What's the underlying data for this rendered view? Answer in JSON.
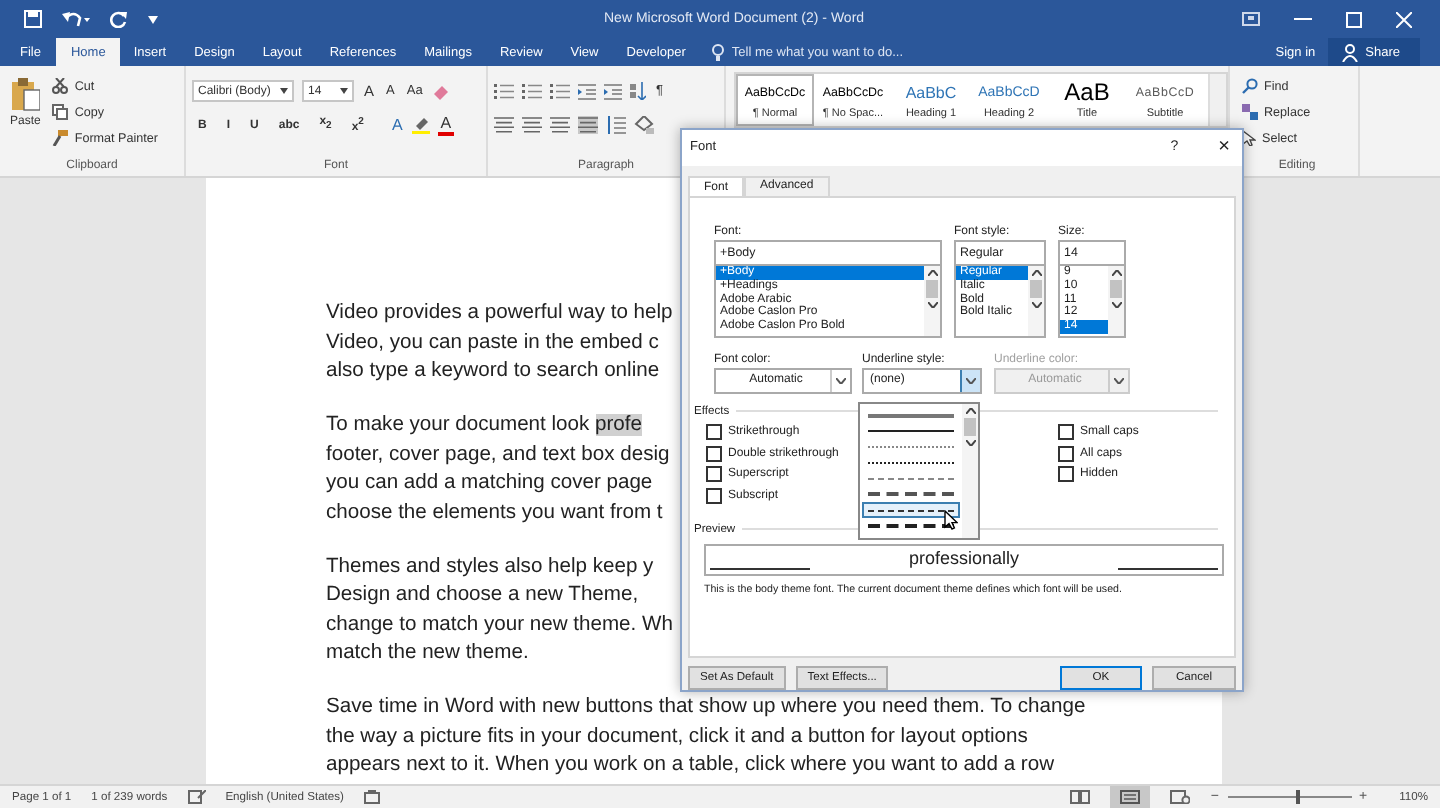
{
  "window": {
    "title": "New Microsoft Word Document (2) - Word"
  },
  "ribbon_tabs": [
    {
      "label": "File",
      "kind": "file",
      "selected": false
    },
    {
      "label": "Home",
      "kind": "tab",
      "selected": true
    },
    {
      "label": "Insert",
      "kind": "tab",
      "selected": false
    },
    {
      "label": "Design",
      "kind": "tab",
      "selected": false
    },
    {
      "label": "Layout",
      "kind": "tab",
      "selected": false
    },
    {
      "label": "References",
      "kind": "tab",
      "selected": false
    },
    {
      "label": "Mailings",
      "kind": "tab",
      "selected": false
    },
    {
      "label": "Review",
      "kind": "tab",
      "selected": false
    },
    {
      "label": "View",
      "kind": "tab",
      "selected": false
    },
    {
      "label": "Developer",
      "kind": "tab",
      "selected": false
    }
  ],
  "tell_me": {
    "placeholder": "Tell me what you want to do..."
  },
  "account": {
    "sign_in": "Sign in",
    "share": "Share"
  },
  "clipboard": {
    "paste": "Paste",
    "cut": "Cut",
    "copy": "Copy",
    "format_painter": "Format Painter",
    "label": "Clipboard"
  },
  "font_group": {
    "name": "Calibri (Body)",
    "size": "14",
    "grow": "A",
    "shrink": "A",
    "change_case": "Aa",
    "format_buttons": [
      "B",
      "I",
      "U",
      "abc",
      "x$_{2}$",
      "x$^{2}$"
    ],
    "text_effects": "A",
    "font_color": "A",
    "label": "Font"
  },
  "paragraph_group": {
    "pilcrow": "¶",
    "label": "Paragraph"
  },
  "styles": [
    {
      "preview": "AaBbCcDc",
      "name": "¶ Normal",
      "kind": "normal",
      "selected": true
    },
    {
      "preview": "AaBbCcDc",
      "name": "¶ No Spac...",
      "kind": "normal",
      "selected": false
    },
    {
      "preview": "AaBbC",
      "name": "Heading 1",
      "kind": "heading1",
      "selected": false
    },
    {
      "preview": "AaBbCcD",
      "name": "Heading 2",
      "kind": "heading2",
      "selected": false
    },
    {
      "preview": "AaB",
      "name": "Title",
      "kind": "title",
      "selected": false
    },
    {
      "preview": "AaBbCcD",
      "name": "Subtitle",
      "kind": "subtitle",
      "selected": false
    }
  ],
  "editing": {
    "find": "Find",
    "replace": "Replace",
    "select": "Select",
    "label": "Editing"
  },
  "document": {
    "paragraphs": [
      {
        "lines": [
          {
            "text": "Video provides a powerful way to help"
          },
          {
            "text": "Video, you can paste in the embed c"
          },
          {
            "text": "also type a keyword to search online"
          }
        ]
      },
      {
        "lines": [
          {
            "text": "To make your document look ",
            "selection": "profe"
          },
          {
            "text": "footer, cover page, and text box desig"
          },
          {
            "text": "you can add a matching cover page"
          },
          {
            "text": "choose the elements you want from t"
          }
        ]
      },
      {
        "lines": [
          {
            "text": "Themes and styles also help keep y"
          },
          {
            "text": "Design and choose a new Theme,"
          },
          {
            "text": "change to match your new theme. Wh"
          },
          {
            "text": "match the new theme."
          }
        ]
      },
      {
        "lines": [
          {
            "text": "Save time in Word with new buttons that show up where you need them. To change"
          },
          {
            "text": "the way a picture fits in your document, click it and a button for layout options"
          },
          {
            "text": "appears next to it. When you work on a table, click where you want to add a row"
          }
        ]
      }
    ]
  },
  "font_dialog": {
    "title": "Font",
    "help": "?",
    "close": "×",
    "tabs": [
      {
        "label": "Font",
        "selected": true
      },
      {
        "label": "Advanced",
        "selected": false
      }
    ],
    "font": {
      "label": "Font:",
      "value": "+Body",
      "items": [
        {
          "label": "+Body",
          "selected": true
        },
        {
          "label": "+Headings",
          "selected": false
        },
        {
          "label": "Adobe Arabic",
          "selected": false
        },
        {
          "label": "Adobe Caslon Pro",
          "selected": false
        },
        {
          "label": "Adobe Caslon Pro Bold",
          "selected": false
        }
      ]
    },
    "font_style": {
      "label": "Font style:",
      "value": "Regular",
      "items": [
        {
          "label": "Regular",
          "selected": true
        },
        {
          "label": "Italic",
          "selected": false
        },
        {
          "label": "Bold",
          "selected": false
        },
        {
          "label": "Bold Italic",
          "selected": false
        }
      ]
    },
    "size": {
      "label": "Size:",
      "value": "14",
      "items": [
        {
          "label": "9",
          "selected": false
        },
        {
          "label": "10",
          "selected": false
        },
        {
          "label": "11",
          "selected": false
        },
        {
          "label": "12",
          "selected": false
        },
        {
          "label": "14",
          "selected": true
        }
      ]
    },
    "font_color": {
      "label": "Font color:",
      "value": "Automatic",
      "disabled": false
    },
    "underline_style": {
      "label": "Underline style:",
      "value": "(none)",
      "expanded": true,
      "disabled": false,
      "options": [
        {
          "kind": "words",
          "selected": false
        },
        {
          "kind": "solid",
          "selected": false
        },
        {
          "kind": "dotted",
          "selected": false
        },
        {
          "kind": "dense",
          "selected": false
        },
        {
          "kind": "dashed",
          "selected": false
        },
        {
          "kind": "heavy",
          "selected": false
        },
        {
          "kind": "long",
          "selected": true
        },
        {
          "kind": "longheavy",
          "selected": false
        }
      ]
    },
    "underline_color": {
      "label": "Underline color:",
      "value": "Automatic",
      "disabled": true
    },
    "effects": {
      "label": "Effects",
      "left": [
        {
          "label": "Strikethrough",
          "checked": false
        },
        {
          "label": "Double strikethrough",
          "checked": false
        },
        {
          "label": "Superscript",
          "checked": false
        },
        {
          "label": "Subscript",
          "checked": false
        }
      ],
      "right": [
        {
          "label": "Small caps",
          "checked": false
        },
        {
          "label": "All caps",
          "checked": false
        },
        {
          "label": "Hidden",
          "checked": false
        }
      ]
    },
    "preview": {
      "label": "Preview",
      "text": "professionally"
    },
    "caption": "This is the body theme font. The current document theme defines which font will be used.",
    "buttons": [
      {
        "label": "Set As Default",
        "kind": "left",
        "default": false
      },
      {
        "label": "Text Effects...",
        "kind": "left",
        "default": false
      },
      {
        "label": "OK",
        "kind": "right",
        "default": true
      },
      {
        "label": "Cancel",
        "kind": "right",
        "default": false
      }
    ]
  },
  "status_bar": {
    "page": "Page 1 of 1",
    "words": "1 of 239 words",
    "language": "English (United States)",
    "zoom_out": "−",
    "zoom_in": "+",
    "zoom": "110%",
    "level": 0.55
  }
}
